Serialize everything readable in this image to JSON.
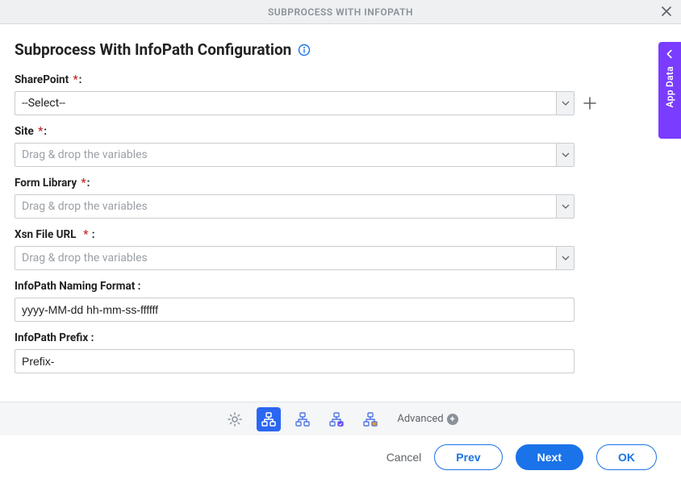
{
  "header": {
    "title": "SUBPROCESS WITH INFOPATH"
  },
  "sidetab": {
    "label": "App Data"
  },
  "page": {
    "title": "Subprocess With InfoPath Configuration"
  },
  "fields": {
    "sharepoint": {
      "label": "SharePoint",
      "required": true,
      "value": "--Select--",
      "is_placeholder": false
    },
    "site": {
      "label": "Site",
      "required": true,
      "placeholder": "Drag & drop the variables",
      "value": ""
    },
    "formlib": {
      "label": "Form Library",
      "required": true,
      "placeholder": "Drag & drop the variables",
      "value": ""
    },
    "xsnurl": {
      "label": "Xsn File URL",
      "required": true,
      "extra_space_before_req": true,
      "placeholder": "Drag & drop the variables",
      "value": ""
    },
    "naming": {
      "label": "InfoPath Naming Format :",
      "value": "yyyy-MM-dd hh-mm-ss-ffffff"
    },
    "prefix": {
      "label": "InfoPath Prefix :",
      "value": "Prefix-"
    }
  },
  "toolbar": {
    "advanced_label": "Advanced"
  },
  "footer": {
    "cancel": "Cancel",
    "prev": "Prev",
    "next": "Next",
    "ok": "OK"
  }
}
